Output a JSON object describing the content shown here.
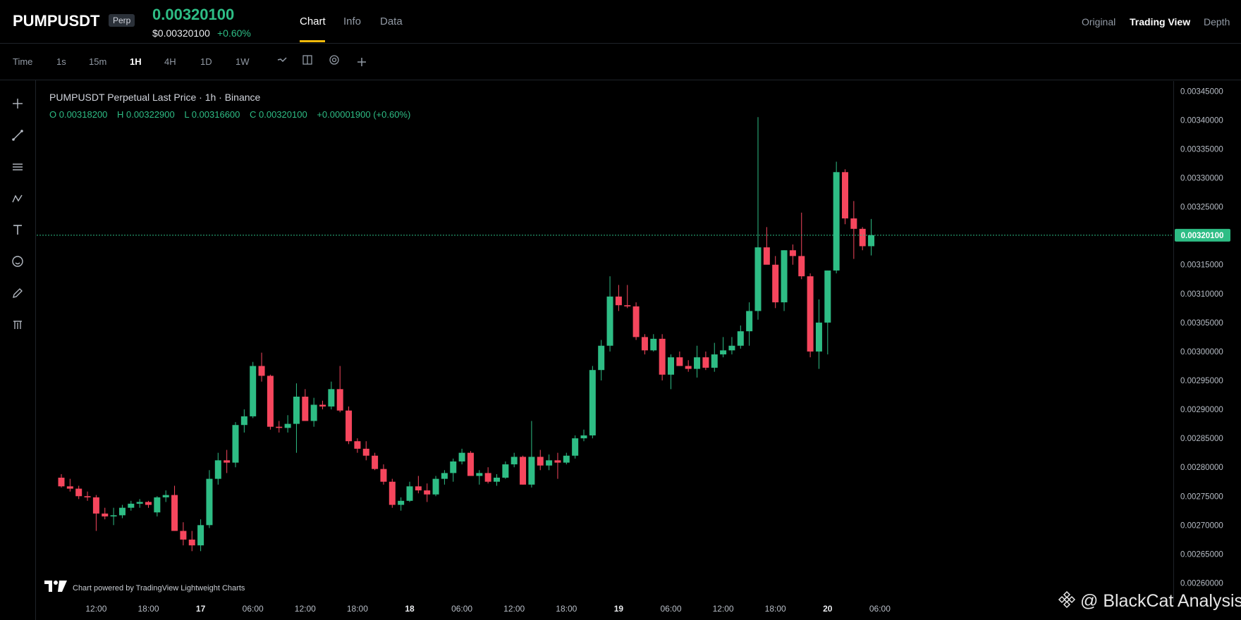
{
  "header": {
    "symbol": "PUMPUSDT",
    "badge": "Perp",
    "last_price": "0.00320100",
    "usd_price": "$0.00320100",
    "change_pct": "+0.60%",
    "tabs": [
      {
        "label": "Chart",
        "active": true
      },
      {
        "label": "Info",
        "active": false
      },
      {
        "label": "Data",
        "active": false
      }
    ],
    "views": [
      {
        "label": "Original",
        "active": false
      },
      {
        "label": "Trading View",
        "active": true
      },
      {
        "label": "Depth",
        "active": false
      }
    ]
  },
  "intervals": {
    "time_label": "Time",
    "items": [
      {
        "label": "1s",
        "active": false
      },
      {
        "label": "15m",
        "active": false
      },
      {
        "label": "1H",
        "active": true
      },
      {
        "label": "4H",
        "active": false
      },
      {
        "label": "1D",
        "active": false
      },
      {
        "label": "1W",
        "active": false
      }
    ],
    "tools": [
      "line-style-icon",
      "layout-icon",
      "settings-circle-icon",
      "plus-icon"
    ]
  },
  "left_toolbar": [
    "crosshair-icon",
    "trendline-icon",
    "horizontal-lines-icon",
    "pattern-icon",
    "text-icon",
    "emoji-icon",
    "pencil-icon",
    "trash-icon"
  ],
  "legend": {
    "title": "PUMPUSDT Perpetual Last Price · 1h · Binance",
    "open": "O 0.00318200",
    "high": "H 0.00322900",
    "low": "L 0.00316600",
    "close": "C 0.00320100",
    "change": "+0.00001900 (+0.60%)"
  },
  "footer": {
    "powered_by": "Chart powered by TradingView Lightweight Charts",
    "watermark": "@ BlackCat Analysis"
  },
  "colors": {
    "up": "#2ebd85",
    "down": "#f6465d",
    "accent": "#f0b90b",
    "background": "#000000"
  },
  "chart_data": {
    "type": "candlestick",
    "title": "PUMPUSDT Perpetual Last Price · 1h · Binance",
    "interval": "1h",
    "current_price": 0.003201,
    "ylim": [
      0.002575,
      0.003465
    ],
    "yticks": [
      0.0026,
      0.00265,
      0.0027,
      0.00275,
      0.0028,
      0.00285,
      0.0029,
      0.00295,
      0.003,
      0.00305,
      0.0031,
      0.00315,
      0.0032,
      0.00325,
      0.0033,
      0.00335,
      0.0034,
      0.00345
    ],
    "xticks": [
      {
        "label": "12:00",
        "index": 4
      },
      {
        "label": "18:00",
        "index": 10
      },
      {
        "label": "17",
        "index": 16
      },
      {
        "label": "06:00",
        "index": 22
      },
      {
        "label": "12:00",
        "index": 28
      },
      {
        "label": "18:00",
        "index": 34
      },
      {
        "label": "18",
        "index": 40
      },
      {
        "label": "06:00",
        "index": 46
      },
      {
        "label": "12:00",
        "index": 52
      },
      {
        "label": "18:00",
        "index": 58
      },
      {
        "label": "19",
        "index": 64
      },
      {
        "label": "06:00",
        "index": 70
      },
      {
        "label": "12:00",
        "index": 76
      },
      {
        "label": "18:00",
        "index": 82
      },
      {
        "label": "20",
        "index": 88
      },
      {
        "label": "06:00",
        "index": 94
      }
    ],
    "candles": [
      [
        0.002782,
        0.002788,
        0.002765,
        0.002767
      ],
      [
        0.002767,
        0.00278,
        0.002758,
        0.002763
      ],
      [
        0.002763,
        0.002768,
        0.002745,
        0.00275
      ],
      [
        0.00275,
        0.002758,
        0.002742,
        0.002748
      ],
      [
        0.002748,
        0.002752,
        0.00269,
        0.00272
      ],
      [
        0.00272,
        0.00273,
        0.00271,
        0.002715
      ],
      [
        0.002715,
        0.00273,
        0.0027,
        0.002717
      ],
      [
        0.002717,
        0.002735,
        0.002712,
        0.00273
      ],
      [
        0.00273,
        0.002742,
        0.002725,
        0.002737
      ],
      [
        0.002737,
        0.002745,
        0.00273,
        0.00274
      ],
      [
        0.00274,
        0.002742,
        0.00273,
        0.002735
      ],
      [
        0.002722,
        0.00275,
        0.002715,
        0.002748
      ],
      [
        0.002748,
        0.00276,
        0.00274,
        0.002752
      ],
      [
        0.002752,
        0.002768,
        0.00269,
        0.00269
      ],
      [
        0.00269,
        0.002705,
        0.002665,
        0.002675
      ],
      [
        0.002675,
        0.00269,
        0.002655,
        0.002665
      ],
      [
        0.002665,
        0.00271,
        0.002655,
        0.0027
      ],
      [
        0.0027,
        0.002795,
        0.002695,
        0.00278
      ],
      [
        0.00278,
        0.002825,
        0.00277,
        0.002812
      ],
      [
        0.002812,
        0.00283,
        0.00279,
        0.002808
      ],
      [
        0.002808,
        0.002878,
        0.0028,
        0.002873
      ],
      [
        0.002873,
        0.0029,
        0.00286,
        0.002888
      ],
      [
        0.002888,
        0.002982,
        0.002885,
        0.002975
      ],
      [
        0.002975,
        0.002998,
        0.002948,
        0.002958
      ],
      [
        0.002958,
        0.00296,
        0.002865,
        0.00287
      ],
      [
        0.00287,
        0.00288,
        0.00286,
        0.002868
      ],
      [
        0.002868,
        0.00289,
        0.00286,
        0.002875
      ],
      [
        0.002875,
        0.002945,
        0.002825,
        0.002922
      ],
      [
        0.002922,
        0.002935,
        0.00288,
        0.00288
      ],
      [
        0.00288,
        0.00292,
        0.00287,
        0.002908
      ],
      [
        0.002908,
        0.002915,
        0.0029,
        0.002905
      ],
      [
        0.002905,
        0.002948,
        0.0029,
        0.002935
      ],
      [
        0.002935,
        0.002975,
        0.002895,
        0.002898
      ],
      [
        0.002898,
        0.002905,
        0.00284,
        0.002845
      ],
      [
        0.002845,
        0.00285,
        0.002825,
        0.002832
      ],
      [
        0.002832,
        0.002845,
        0.002812,
        0.00282
      ],
      [
        0.00282,
        0.002825,
        0.002795,
        0.002797
      ],
      [
        0.002797,
        0.002805,
        0.00277,
        0.002775
      ],
      [
        0.002775,
        0.00278,
        0.00273,
        0.002735
      ],
      [
        0.002735,
        0.002748,
        0.002725,
        0.002742
      ],
      [
        0.002742,
        0.002775,
        0.00274,
        0.002767
      ],
      [
        0.002767,
        0.002785,
        0.002755,
        0.00276
      ],
      [
        0.00276,
        0.002772,
        0.00274,
        0.002753
      ],
      [
        0.002753,
        0.002785,
        0.00275,
        0.00278
      ],
      [
        0.00278,
        0.002795,
        0.00277,
        0.00279
      ],
      [
        0.00279,
        0.002815,
        0.002775,
        0.00281
      ],
      [
        0.00281,
        0.002832,
        0.002805,
        0.002825
      ],
      [
        0.002825,
        0.002828,
        0.002785,
        0.002785
      ],
      [
        0.002785,
        0.002795,
        0.00277,
        0.00279
      ],
      [
        0.00279,
        0.0028,
        0.002772,
        0.002775
      ],
      [
        0.002775,
        0.002788,
        0.002768,
        0.002782
      ],
      [
        0.002782,
        0.00281,
        0.00278,
        0.002805
      ],
      [
        0.002805,
        0.002825,
        0.0028,
        0.002818
      ],
      [
        0.002818,
        0.00282,
        0.00277,
        0.00277
      ],
      [
        0.00277,
        0.00288,
        0.002765,
        0.002818
      ],
      [
        0.002818,
        0.00283,
        0.002795,
        0.002803
      ],
      [
        0.002803,
        0.002822,
        0.002795,
        0.002812
      ],
      [
        0.002812,
        0.002825,
        0.00278,
        0.002808
      ],
      [
        0.002808,
        0.002825,
        0.002805,
        0.00282
      ],
      [
        0.00282,
        0.002855,
        0.002815,
        0.00285
      ],
      [
        0.00285,
        0.002865,
        0.002845,
        0.002855
      ],
      [
        0.002855,
        0.002975,
        0.00285,
        0.002968
      ],
      [
        0.002968,
        0.00302,
        0.00295,
        0.00301
      ],
      [
        0.00301,
        0.00313,
        0.003,
        0.003095
      ],
      [
        0.003095,
        0.003115,
        0.00307,
        0.00308
      ],
      [
        0.00308,
        0.003115,
        0.003075,
        0.003078
      ],
      [
        0.003078,
        0.003085,
        0.00302,
        0.003025
      ],
      [
        0.003025,
        0.00303,
        0.002995,
        0.003002
      ],
      [
        0.003002,
        0.00303,
        0.003,
        0.003022
      ],
      [
        0.003022,
        0.00303,
        0.00295,
        0.00296
      ],
      [
        0.00296,
        0.002995,
        0.002935,
        0.00299
      ],
      [
        0.00299,
        0.003,
        0.002975,
        0.002975
      ],
      [
        0.002975,
        0.002985,
        0.002965,
        0.00297
      ],
      [
        0.00297,
        0.00301,
        0.002955,
        0.00299
      ],
      [
        0.00299,
        0.003,
        0.002968,
        0.002972
      ],
      [
        0.002972,
        0.003015,
        0.002965,
        0.002995
      ],
      [
        0.002995,
        0.003025,
        0.00299,
        0.003002
      ],
      [
        0.003002,
        0.003025,
        0.002995,
        0.00301
      ],
      [
        0.00301,
        0.003045,
        0.003005,
        0.003035
      ],
      [
        0.003035,
        0.003085,
        0.00301,
        0.00307
      ],
      [
        0.00307,
        0.003405,
        0.003055,
        0.00318
      ],
      [
        0.00318,
        0.003215,
        0.00316,
        0.00315
      ],
      [
        0.00315,
        0.003165,
        0.003075,
        0.003085
      ],
      [
        0.003085,
        0.003175,
        0.00307,
        0.003175
      ],
      [
        0.003175,
        0.003185,
        0.00315,
        0.003165
      ],
      [
        0.003165,
        0.00324,
        0.003125,
        0.00313
      ],
      [
        0.00313,
        0.003135,
        0.00299,
        0.003
      ],
      [
        0.003,
        0.00309,
        0.00297,
        0.00305
      ],
      [
        0.00305,
        0.00314,
        0.002995,
        0.00314
      ],
      [
        0.00314,
        0.003328,
        0.003135,
        0.00331
      ],
      [
        0.00331,
        0.003315,
        0.00322,
        0.00323
      ],
      [
        0.00323,
        0.00326,
        0.00316,
        0.003212
      ],
      [
        0.003212,
        0.003215,
        0.003175,
        0.003182
      ],
      [
        0.003182,
        0.003229,
        0.003166,
        0.003201
      ]
    ]
  }
}
